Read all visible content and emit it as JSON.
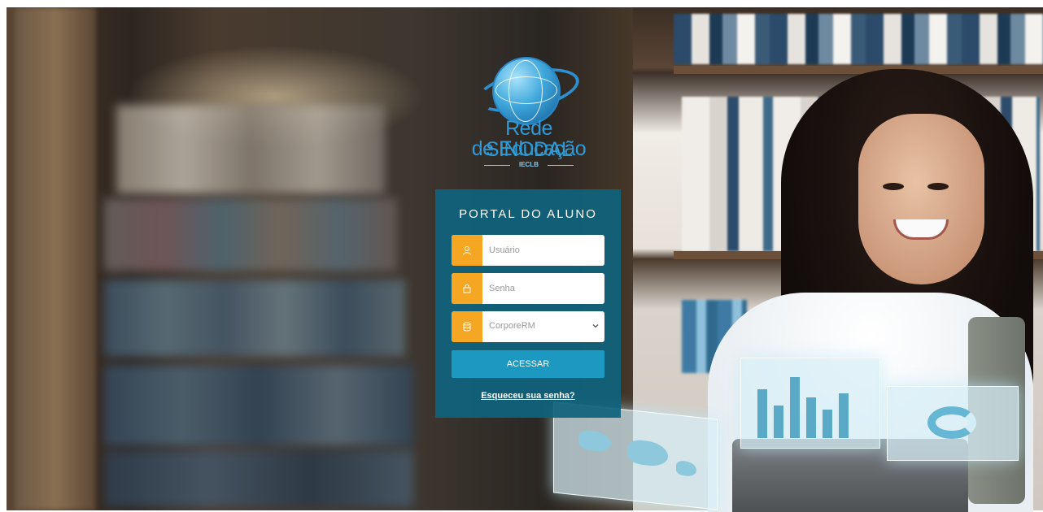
{
  "brand": {
    "name_line1_a": "Rede",
    "name_line1_b": "SINODAL",
    "name_line2": "de Educação",
    "tagline": "IECLB"
  },
  "login": {
    "title": "PORTAL DO ALUNO",
    "username_placeholder": "Usuário",
    "password_placeholder": "Senha",
    "database_selected": "CorporeRM",
    "submit_label": "ACESSAR",
    "forgot_link": "Esqueceu sua senha?"
  },
  "colors": {
    "panel": "#0f637d",
    "accent_icon": "#f5a623",
    "button": "#1d98c0",
    "logo_blue": "#2f9ad8"
  },
  "icons": {
    "user": "user-icon",
    "lock": "lock-icon",
    "database": "database-icon",
    "chevron": "chevron-down-icon"
  }
}
